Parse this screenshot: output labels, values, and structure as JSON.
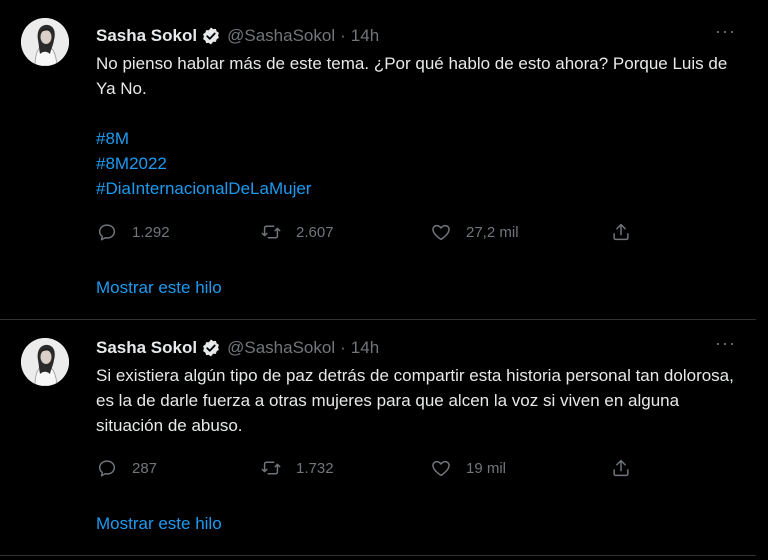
{
  "colors": {
    "background": "#000000",
    "text": "#e7e9ea",
    "muted": "#71767b",
    "accent": "#1d9bf0",
    "border": "#2f3336"
  },
  "tweets": [
    {
      "author": "Sasha Sokol",
      "handle": "@SashaSokol",
      "separator": "·",
      "time": "14h",
      "text": "No pienso hablar más de este tema. ¿Por qué hablo de esto ahora? Porque Luis de Ya No.",
      "hashtags": [
        "#8M",
        "#8M2022",
        "#DiaInternacionalDeLaMujer"
      ],
      "replies": "1.292",
      "retweets": "2.607",
      "likes": "27,2 mil",
      "show_thread": "Mostrar este hilo",
      "icons": [
        "verified-icon",
        "more-icon",
        "reply-icon",
        "retweet-icon",
        "like-icon",
        "share-icon"
      ]
    },
    {
      "author": "Sasha Sokol",
      "handle": "@SashaSokol",
      "separator": "·",
      "time": "14h",
      "text": "Si existiera algún tipo de paz detrás de compartir esta historia personal tan dolorosa, es la de darle fuerza a otras mujeres para que alcen la voz si viven en alguna situación de abuso.",
      "replies": "287",
      "retweets": "1.732",
      "likes": "19 mil",
      "show_thread": "Mostrar este hilo",
      "icons": [
        "verified-icon",
        "more-icon",
        "reply-icon",
        "retweet-icon",
        "like-icon",
        "share-icon"
      ]
    }
  ]
}
